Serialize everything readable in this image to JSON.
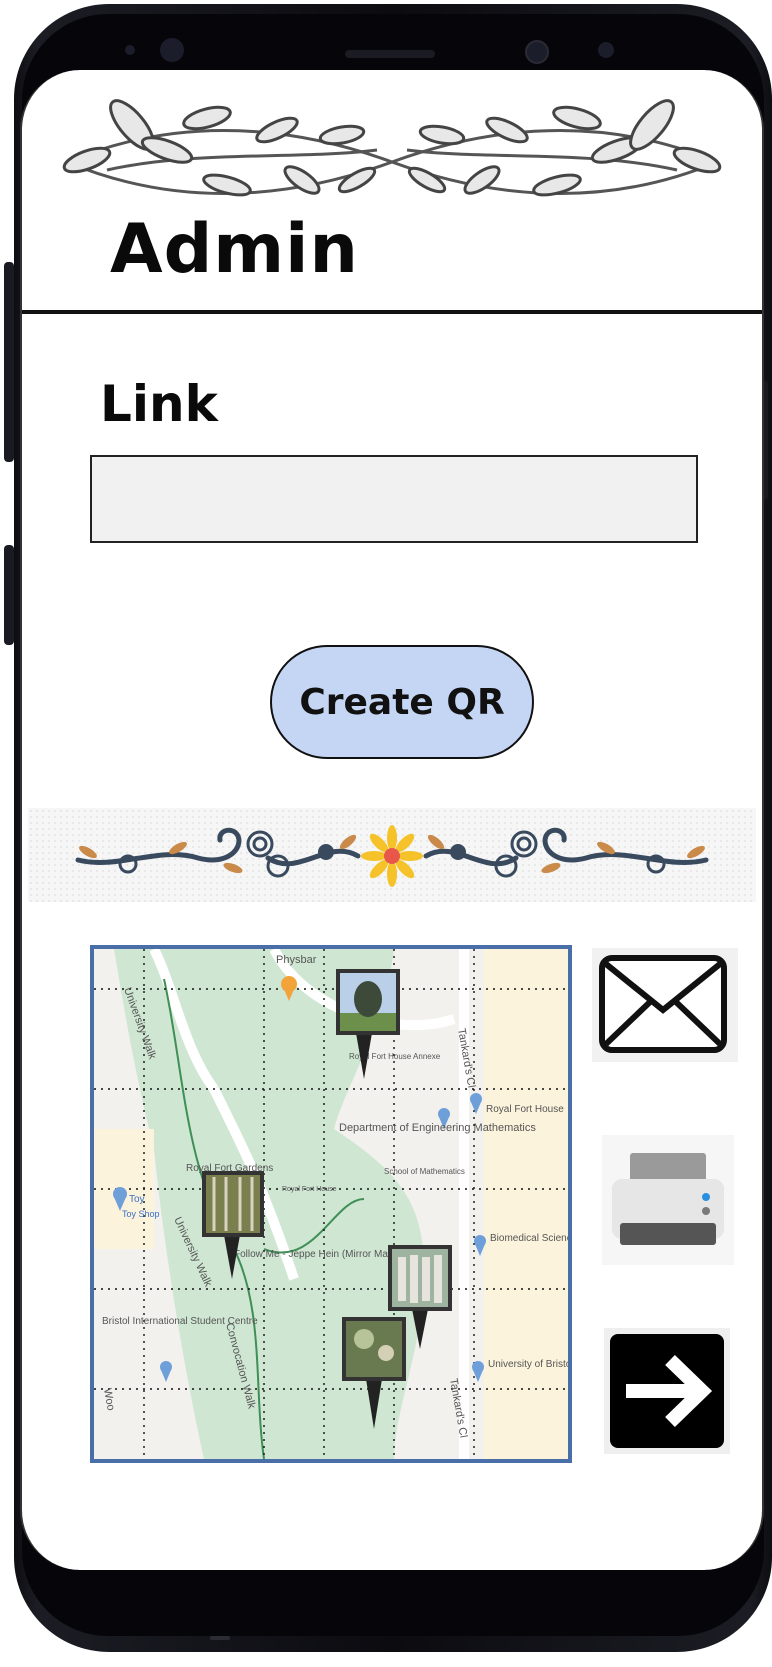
{
  "header": {
    "title": "Admin"
  },
  "form": {
    "link_label": "Link",
    "link_value": "",
    "link_placeholder": "",
    "create_button_label": "Create QR"
  },
  "map": {
    "places": [
      {
        "label": "Physbar",
        "icon": "food-pin-icon"
      },
      {
        "label": "Royal Fort House Annexe"
      },
      {
        "label": "Department of Engineering Mathematics",
        "icon": "pin-icon"
      },
      {
        "label": "School of Mathematics"
      },
      {
        "label": "Royal Fort House",
        "icon": "pin-icon"
      },
      {
        "label": "Royal Fort Gardens"
      },
      {
        "label": "Royal Fort House"
      },
      {
        "label": "Toy Shop",
        "icon": "shop-pin-icon"
      },
      {
        "label": "Follow Me - Jeppe Hein (Mirror Maze)"
      },
      {
        "label": "Biomedical Sciences Building",
        "icon": "pin-icon"
      },
      {
        "label": "Bristol International Student Centre",
        "icon": "pin-icon"
      },
      {
        "label": "University of Bristol Medical Library",
        "icon": "pin-icon"
      }
    ],
    "streets": [
      "University Walk",
      "University Walk",
      "Tankard's Cl",
      "Tankard's Cl",
      "Convocation Walk",
      "Woo"
    ],
    "toy_small": "Toy"
  },
  "actions": {
    "mail_icon": "envelope-icon",
    "print_icon": "printer-icon",
    "next_icon": "arrow-right-icon"
  },
  "colors": {
    "button_fill": "#c5d6f5",
    "map_border": "#4a6ea8",
    "park_green": "#cfe6d2",
    "pin_orange": "#f2a33a",
    "pin_blue": "#6f9fd8"
  }
}
